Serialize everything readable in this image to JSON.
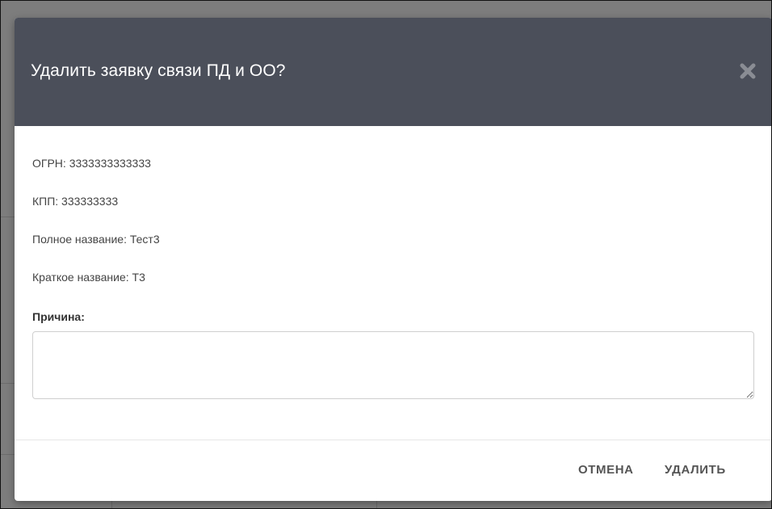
{
  "dialog": {
    "title": "Удалить заявку связи ПД и ОО?",
    "close_icon": "close-icon",
    "fields": [
      {
        "label": "ОГРН",
        "value": "3333333333333",
        "text": "ОГРН: 3333333333333"
      },
      {
        "label": "КПП",
        "value": "333333333",
        "text": "КПП: 333333333"
      },
      {
        "label": "Полное название",
        "value": "Тест3",
        "text": "Полное название: Тест3"
      },
      {
        "label": "Краткое название",
        "value": "Т3",
        "text": "Краткое название: Т3"
      }
    ],
    "reason": {
      "label": "Причина:",
      "value": "",
      "placeholder": ""
    },
    "buttons": {
      "cancel_label": "ОТМЕНА",
      "delete_label": "УДАЛИТЬ"
    }
  },
  "colors": {
    "header_bg": "#4b4f5a",
    "overlay_bg": "#7d7d7d",
    "button_text": "#555555"
  }
}
